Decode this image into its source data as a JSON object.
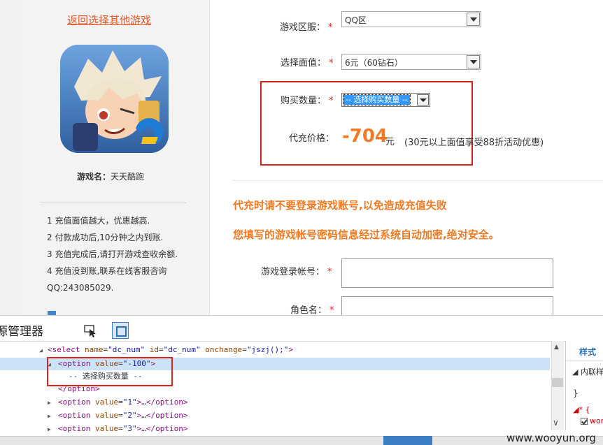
{
  "left": {
    "back_link": "返回选择其他游戏",
    "game_name_label": "游戏名：",
    "game_name": "天天酷跑",
    "notes": [
      "1 充值面值越大，优惠越高.",
      "2 付款成功后,10分钟之内到账.",
      "3 充值完成后,请打开游戏查收余额.",
      "4 充值没到账,联系在线客服咨询",
      "QQ:243085029."
    ]
  },
  "form": {
    "server_label": "游戏区服：",
    "server_value": "QQ区",
    "face_value_label": "选择面值：",
    "face_value": "6元（60钻石）",
    "quantity_label": "购买数量：",
    "quantity_value": "-- 选择购买数量 --",
    "price_label": "代充价格：",
    "price_value": "-704",
    "price_unit": "元",
    "price_note": "(30元以上面值享受88折活动优惠)",
    "warning1": "代充时请不要登录游戏账号,以免造成充值失败",
    "warning2": "您填写的游戏帐号密码信息经过系统自动加密,绝对安全。",
    "account_label": "游戏登录帐号：",
    "role_label": "角色名："
  },
  "devtools": {
    "title": "源管理器",
    "code_lines": [
      {
        "indent": 0,
        "html": "<select name=\"dc_num\" id=\"dc_num\" onchange=\"jszj();\">"
      },
      {
        "indent": 1,
        "html": "<option value=\"-100\">"
      },
      {
        "indent": 2,
        "text": "-- 选择购买数量 --"
      },
      {
        "indent": 1,
        "html": "</option>"
      },
      {
        "indent": 1,
        "html": "<option value=\"1\">…</option>"
      },
      {
        "indent": 1,
        "html": "<option value=\"2\">…</option>"
      },
      {
        "indent": 1,
        "html": "<option value=\"3\">…</option>"
      }
    ],
    "styles_tab": "样式",
    "styles_inline": "内联样式",
    "styles_brace": "}",
    "styles_rule": "*  {",
    "styles_prop": "wor"
  },
  "watermark": "www.wooyun.org"
}
